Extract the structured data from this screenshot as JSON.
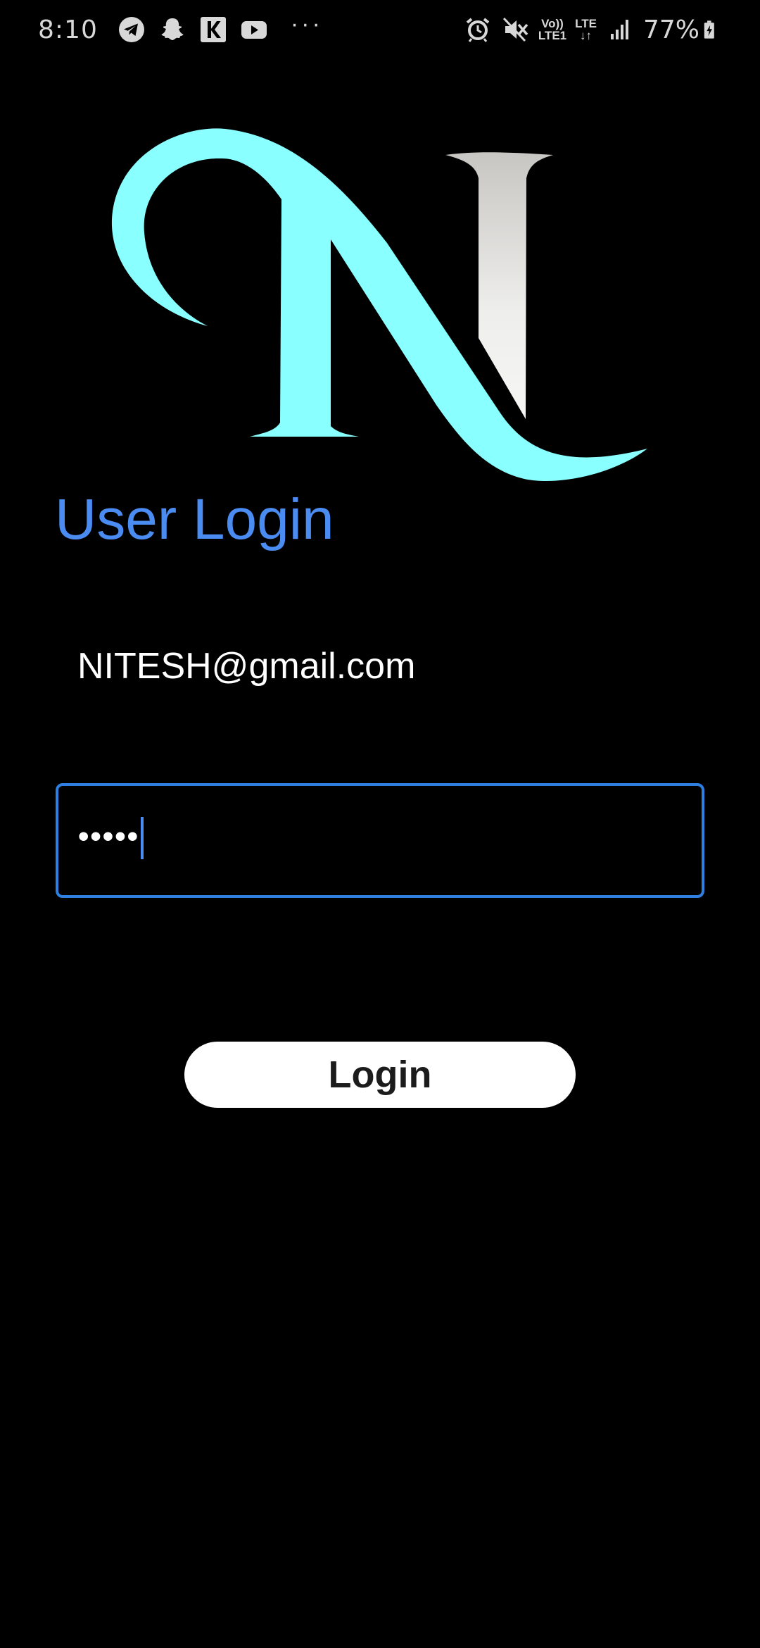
{
  "status_bar": {
    "time": "8:10",
    "left_icons": [
      "telegram-icon",
      "snapchat-icon",
      "k-app-icon",
      "youtube-icon"
    ],
    "more": "···",
    "right_icons": [
      "alarm-icon",
      "mute-icon",
      "volte-icon",
      "lte-icon",
      "signal-icon",
      "battery-charging-icon"
    ],
    "volte_top": "Vo))",
    "volte_bottom": "LTE1",
    "lte_top": "LTE",
    "lte_bottom": "↓↑",
    "battery": "77%"
  },
  "logo": {
    "letter": "N",
    "colors": {
      "swoosh": "#8affff",
      "stem_light": "#f3f3f1",
      "stem_dark": "#c8c6c2"
    }
  },
  "page_title": "User Login",
  "email": {
    "value": "NITESH@gmail.com"
  },
  "password": {
    "masked": "•••••"
  },
  "login_button": {
    "label": "Login"
  },
  "colors": {
    "background": "#000000",
    "accent": "#4a8cf2",
    "focus_border": "#2f7fe0",
    "button_bg": "#ffffff",
    "button_text": "#1c1c1c"
  }
}
